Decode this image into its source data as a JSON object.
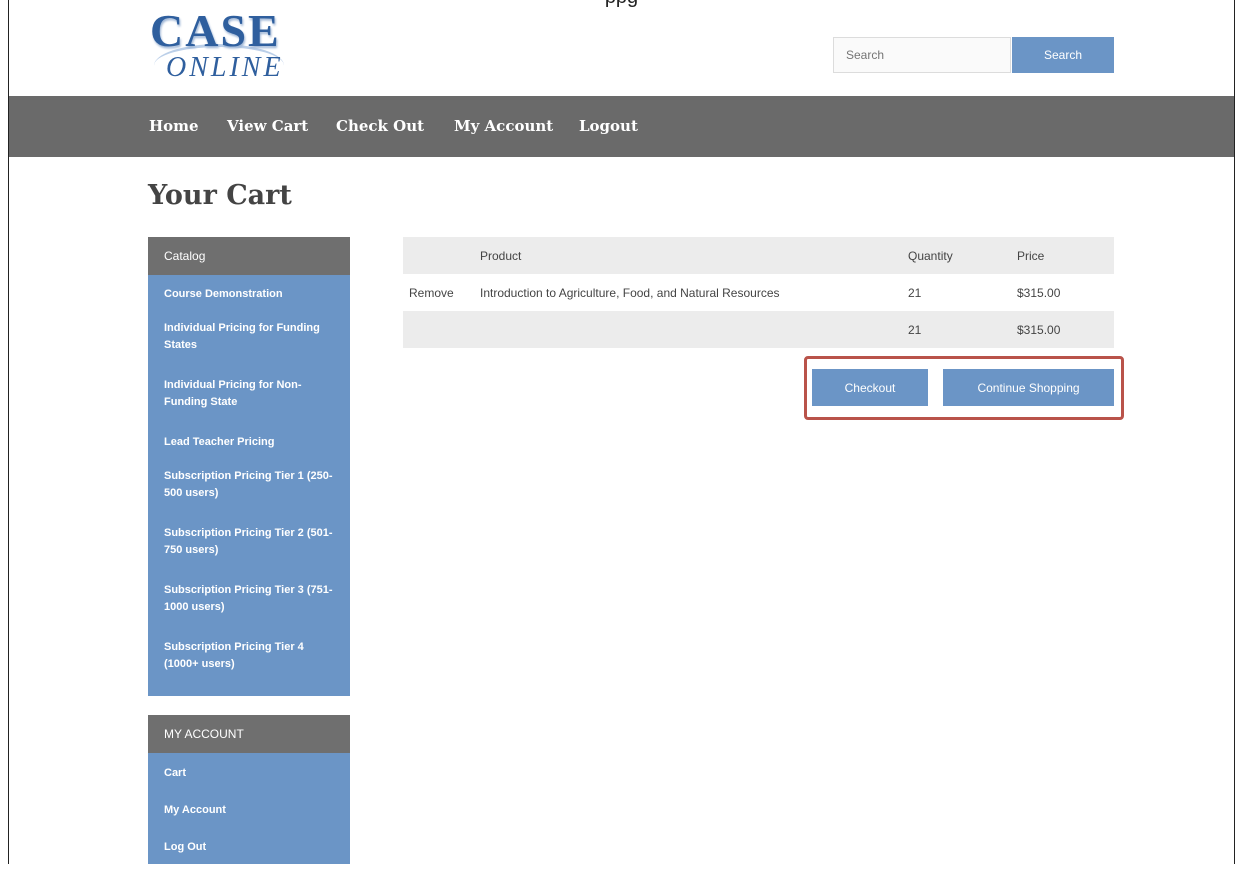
{
  "caption": "ppg",
  "logo": {
    "line1": "CASE",
    "line2": "ONLINE"
  },
  "search": {
    "placeholder": "Search",
    "button_label": "Search"
  },
  "nav": [
    "Home",
    "View Cart",
    "Check Out",
    "My Account",
    "Logout"
  ],
  "page_title": "Your Cart",
  "catalog": {
    "header": "Catalog",
    "items": [
      "Course Demonstration",
      "Individual Pricing for Funding States",
      "Individual Pricing for Non-Funding State",
      "Lead Teacher Pricing",
      "Subscription Pricing Tier 1 (250-500 users)",
      "Subscription Pricing Tier 2 (501-750 users)",
      "Subscription Pricing Tier 3 (751-1000 users)",
      "Subscription Pricing Tier 4 (1000+ users)"
    ]
  },
  "my_account": {
    "header": "MY ACCOUNT",
    "items": [
      "Cart",
      "My Account",
      "Log Out"
    ]
  },
  "cart": {
    "headers": [
      "",
      "Product",
      "Quantity",
      "Price"
    ],
    "rows": [
      {
        "action": "Remove",
        "product": "Introduction to Agriculture, Food, and Natural Resources",
        "quantity": "21",
        "price": "$315.00"
      }
    ],
    "total": {
      "quantity": "21",
      "price": "$315.00"
    }
  },
  "buttons": {
    "checkout": "Checkout",
    "continue_shopping": "Continue Shopping"
  },
  "colors": {
    "accent": "#6b95c6",
    "nav_bg": "#6a6a6a",
    "highlight": "#b9534a"
  }
}
